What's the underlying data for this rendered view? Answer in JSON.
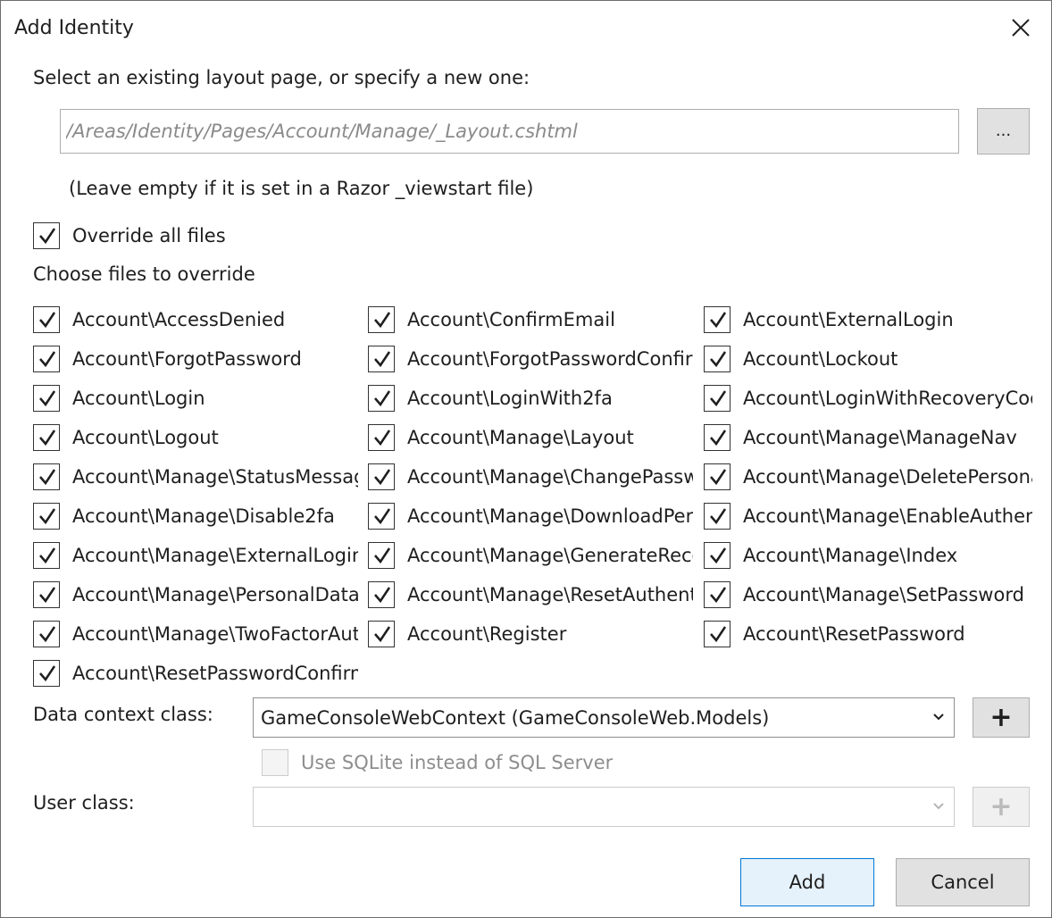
{
  "dialog": {
    "title": "Add Identity",
    "close_icon": "close-icon"
  },
  "layout": {
    "prompt": "Select an existing layout page, or specify a new one:",
    "value": "",
    "placeholder": "/Areas/Identity/Pages/Account/Manage/_Layout.cshtml",
    "browse_label": "...",
    "hint": "(Leave empty if it is set in a Razor _viewstart file)"
  },
  "override_all": {
    "label": "Override all files",
    "checked": true
  },
  "choose_files_label": "Choose files to override",
  "files": [
    [
      "Account\\AccessDenied",
      "Account\\ConfirmEmail",
      "Account\\ExternalLogin"
    ],
    [
      "Account\\ForgotPassword",
      "Account\\ForgotPasswordConfirmation",
      "Account\\Lockout"
    ],
    [
      "Account\\Login",
      "Account\\LoginWith2fa",
      "Account\\LoginWithRecoveryCode"
    ],
    [
      "Account\\Logout",
      "Account\\Manage\\Layout",
      "Account\\Manage\\ManageNav"
    ],
    [
      "Account\\Manage\\StatusMessage",
      "Account\\Manage\\ChangePassword",
      "Account\\Manage\\DeletePersonalData"
    ],
    [
      "Account\\Manage\\Disable2fa",
      "Account\\Manage\\DownloadPersonalData",
      "Account\\Manage\\EnableAuthenticator"
    ],
    [
      "Account\\Manage\\ExternalLogins",
      "Account\\Manage\\GenerateRecoveryCodes",
      "Account\\Manage\\Index"
    ],
    [
      "Account\\Manage\\PersonalData",
      "Account\\Manage\\ResetAuthenticator",
      "Account\\Manage\\SetPassword"
    ],
    [
      "Account\\Manage\\TwoFactorAuthentication",
      "Account\\Register",
      "Account\\ResetPassword"
    ],
    [
      "Account\\ResetPasswordConfirmation"
    ]
  ],
  "data_context": {
    "label": "Data context class:",
    "value": "GameConsoleWebContext (GameConsoleWeb.Models)",
    "add_label": "+"
  },
  "sqlite": {
    "label": "Use SQLite instead of SQL Server",
    "checked": false,
    "enabled": false
  },
  "user_class": {
    "label": "User class:",
    "value": "",
    "add_label": "+"
  },
  "buttons": {
    "add": "Add",
    "cancel": "Cancel"
  }
}
